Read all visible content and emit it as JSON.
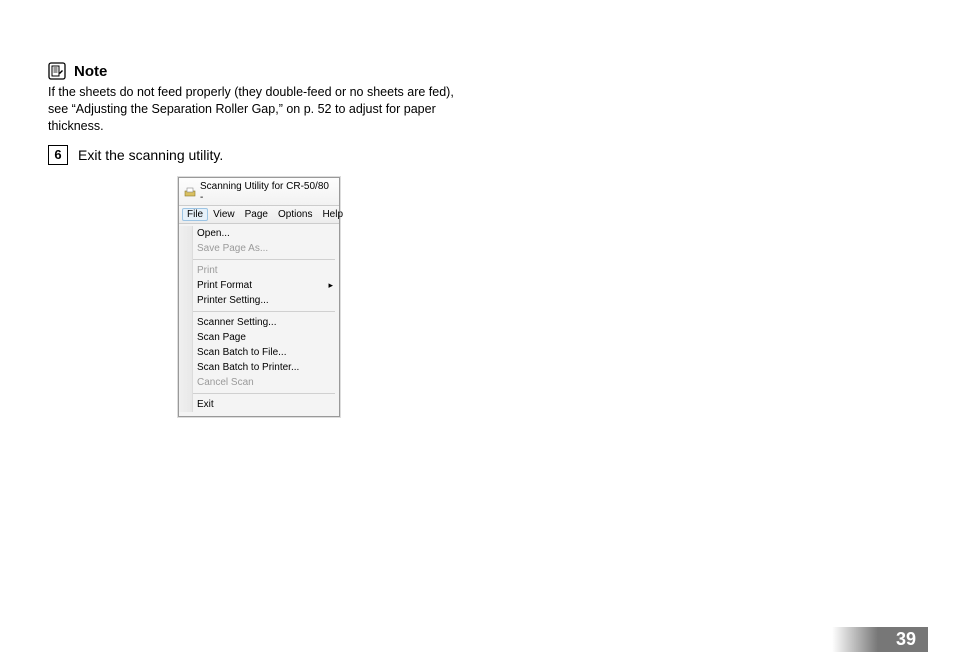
{
  "note": {
    "title": "Note",
    "body": "If the sheets do not feed properly (they double-feed or no sheets are fed), see “Adjusting the Separation Roller Gap,” on p. 52 to adjust for paper thickness."
  },
  "step": {
    "number": "6",
    "text": "Exit the scanning utility."
  },
  "win": {
    "title": "Scanning Utility for CR-50/80 -",
    "menubar": [
      "File",
      "View",
      "Page",
      "Options",
      "Help"
    ],
    "menu": {
      "open": "Open...",
      "save_as": "Save Page As...",
      "print": "Print",
      "print_format": "Print Format",
      "printer_setting": "Printer Setting...",
      "scanner_setting": "Scanner Setting...",
      "scan_page": "Scan Page",
      "scan_batch_file": "Scan Batch to File...",
      "scan_batch_printer": "Scan Batch to Printer...",
      "cancel_scan": "Cancel Scan",
      "exit": "Exit"
    }
  },
  "page_number": "39"
}
